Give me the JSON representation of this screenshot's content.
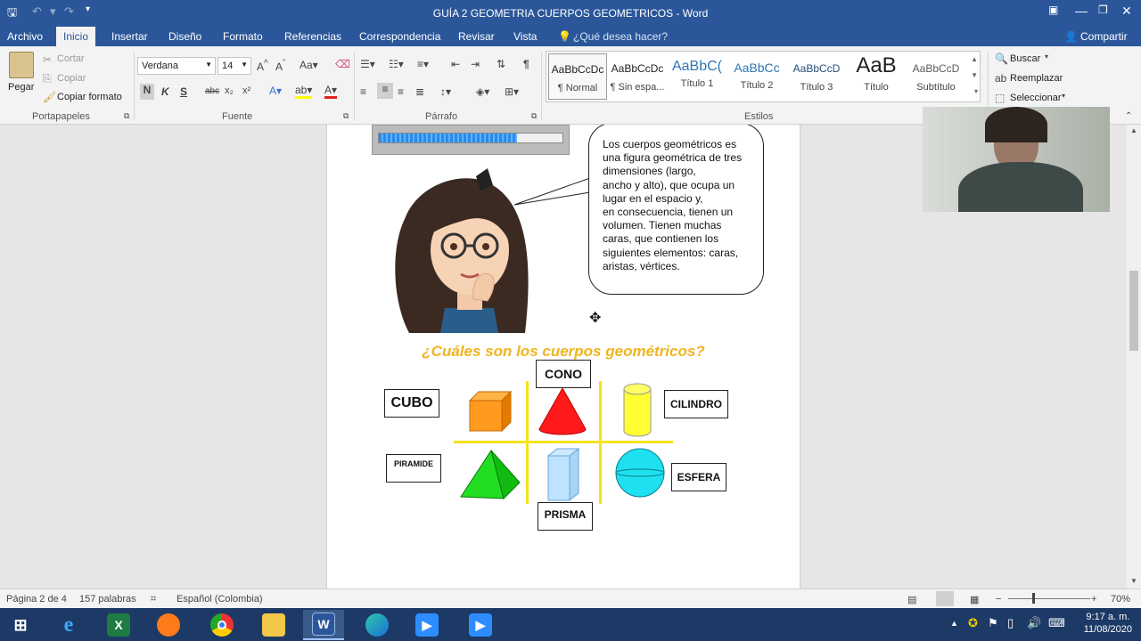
{
  "window": {
    "title": "GUÍA 2 GEOMETRIA CUERPOS GEOMETRICOS - Word"
  },
  "tabs": [
    {
      "label": "Archivo"
    },
    {
      "label": "Inicio"
    },
    {
      "label": "Insertar"
    },
    {
      "label": "Diseño"
    },
    {
      "label": "Formato"
    },
    {
      "label": "Referencias"
    },
    {
      "label": "Correspondencia"
    },
    {
      "label": "Revisar"
    },
    {
      "label": "Vista"
    }
  ],
  "tell_me": "¿Qué desea hacer?",
  "share": "Compartir",
  "clipboard": {
    "paste": "Pegar",
    "cut": "Cortar",
    "copy": "Copiar",
    "format_painter": "Copiar formato",
    "label": "Portapapeles"
  },
  "font": {
    "name": "Verdana",
    "size": "14",
    "label": "Fuente",
    "bold": "N",
    "italic": "K",
    "underline": "S",
    "strike": "abc",
    "sub": "x₂",
    "sup": "x²"
  },
  "paragraph": {
    "label": "Párrafo"
  },
  "styles": {
    "label": "Estilos",
    "items": [
      {
        "preview": "AaBbCcDc",
        "name": "¶ Normal"
      },
      {
        "preview": "AaBbCcDc",
        "name": "¶ Sin espa..."
      },
      {
        "preview": "AaBbC(",
        "name": "Título 1"
      },
      {
        "preview": "AaBbCc",
        "name": "Título 2"
      },
      {
        "preview": "AaBbCcD",
        "name": "Título 3"
      },
      {
        "preview": "AaB",
        "name": "Título"
      },
      {
        "preview": "AaBbCcD",
        "name": "Subtítulo"
      }
    ]
  },
  "editing": {
    "find": "Buscar",
    "replace": "Reemplazar",
    "select": "Seleccionar"
  },
  "document": {
    "progress": 0.75,
    "bubble_lines": [
      "Los cuerpos geométricos es",
      "una figura geométrica de tres",
      "dimensiones (largo,",
      "ancho y alto), que ocupa un",
      "lugar en el espacio y,",
      "en consecuencia, tienen un",
      "volumen. Tienen muchas",
      "caras, que contienen los",
      "siguientes elementos: caras,",
      "aristas, vértices."
    ],
    "question": "¿Cuáles son los cuerpos geométricos?",
    "shapes": {
      "cubo": "CUBO",
      "cono": "CONO",
      "cilindro": "CILINDRO",
      "piramide": "PIRAMIDE",
      "prisma": "PRISMA",
      "esfera": "ESFERA"
    }
  },
  "status": {
    "page": "Página 2 de 4",
    "words": "157 palabras",
    "language": "Español (Colombia)",
    "zoom": "70%"
  },
  "taskbar": {
    "time": "9:17 a. m.",
    "date": "11/08/2020"
  },
  "colors": {
    "brand": "#2b579a",
    "accent_yellow": "#f0b41e"
  }
}
